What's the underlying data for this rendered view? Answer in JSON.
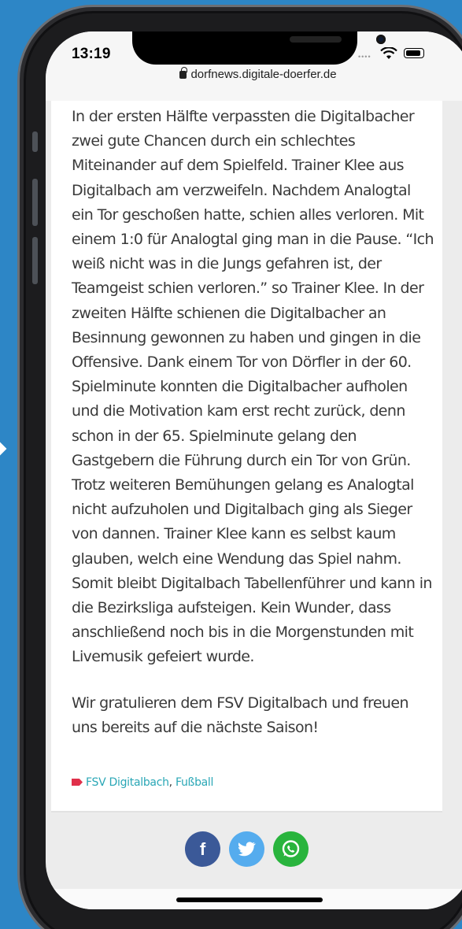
{
  "status": {
    "time": "13:19",
    "url": "dorfnews.digitale-doerfer.de"
  },
  "article": {
    "paragraphs": [
      "In der ersten Hälfte verpassten die Digitalbacher zwei gute Chancen durch ein schlechtes Miteinander auf dem Spielfeld. Trainer Klee aus Digitalbach am verzweifeln. Nachdem Analogtal ein Tor geschoßen hatte, schien alles verloren. Mit einem 1:0 für Analogtal ging man in die Pause. “Ich weiß nicht was in die Jungs gefahren ist, der Teamgeist schien verloren.” so Trainer Klee. In der zweiten Hälfte schienen die Digitalbacher an Besinnung gewonnen zu haben und gingen in die Offensive. Dank einem Tor von Dörfler in der 60. Spielminute konnten die Digitalbacher aufholen und die Motivation kam erst recht zurück, denn schon in der 65. Spielminute gelang den Gastgebern die Führung durch ein Tor von Grün. Trotz weiteren Bemühungen gelang es Analogtal nicht aufzuholen und Digitalbach ging als Sieger von dannen. Trainer Klee kann es selbst kaum glauben, welch eine Wendung das Spiel nahm. Somit bleibt Digitalbach Tabellenführer und kann in die Bezirksliga aufsteigen. Kein Wunder, dass anschließend noch bis in die Morgenstunden mit Livemusik gefeiert wurde.",
      "Wir gratulieren dem FSV Digitalbach und freuen uns bereits auf die nächste Saison!"
    ],
    "tags": [
      "FSV Digitalbach",
      "Fußball"
    ],
    "tag_separator": ","
  },
  "share": {
    "facebook": "f",
    "twitter": "🐦",
    "whatsapp": "✆"
  },
  "colors": {
    "background": "#2d86c6",
    "tag_link": "#2aa7b6",
    "facebook": "#3b5998",
    "twitter": "#55acee",
    "whatsapp": "#29b43d"
  }
}
